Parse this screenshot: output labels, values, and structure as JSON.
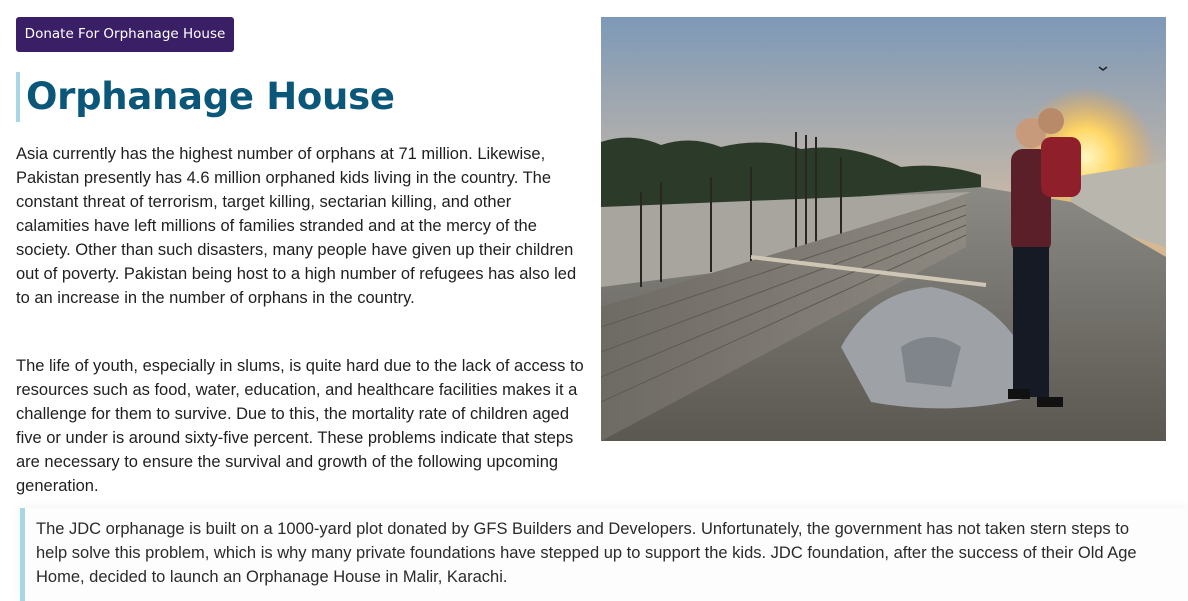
{
  "donate_button": {
    "label": "Donate For Orphanage House"
  },
  "header": {
    "title": "Orphanage House"
  },
  "content": {
    "paragraph_1": "Asia currently has the highest number of orphans at 71 million. Likewise, Pakistan presently has 4.6 million orphaned kids living in the country. The constant threat of terrorism, target killing, sectarian killing, and other calamities have left millions of families stranded and at the mercy of the society. Other than such disasters, many people have given up their children out of poverty. Pakistan being host to a high number of refugees has also led to an increase in the number of orphans in the country.",
    "paragraph_2": "The life of youth, especially in slums, is quite hard due to the lack of access to resources such as food, water, education, and healthcare facilities makes it a challenge for them to survive. Due to this, the mortality rate of children aged five or under is around sixty-five percent. These problems indicate that steps are necessary to ensure the survival and growth of the following upcoming generation."
  },
  "quote": {
    "text": "The JDC orphanage is built on a 1000-yard plot donated by GFS Builders and Developers. Unfortunately, the government has not taken stern steps to help solve this problem, which is why many private foundations have stepped up to support the kids. JDC foundation, after the success of their Old Age Home, decided to launch an Orphanage House in Malir, Karachi."
  },
  "colors": {
    "button_bg": "#3a1f66",
    "title": "#0b5779",
    "accent_border": "#a9d6e5"
  }
}
